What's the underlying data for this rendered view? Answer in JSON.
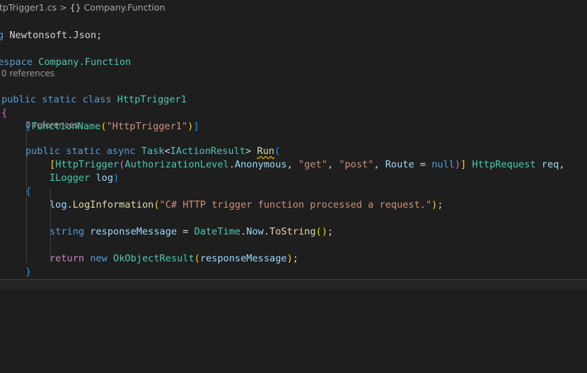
{
  "breadcrumb": {
    "file": "ttpTrigger1.cs",
    "separator": ">",
    "symbol_icon": "{}",
    "symbol": "Company.Function"
  },
  "code": {
    "l1_kw": "g",
    "l1_ns": "Newtonsoft.Json",
    "l1_semi": ";",
    "l2_kw": "espace",
    "l2_ns": "Company.Function",
    "lens1": "0 references",
    "l3_mods": "public static class",
    "l3_name": "HttpTrigger1",
    "l4_brace": "{",
    "l5_open": "[",
    "l5_attr": "FunctionName",
    "l5_p1": "(",
    "l5_str": "\"HttpTrigger1\"",
    "l5_p2": ")",
    "l5_close": "]",
    "lens2": "0 references",
    "l6_mods": "public static async",
    "l6_task": "Task",
    "l6_lt": "<",
    "l6_iface": "IActionResult",
    "l6_gt": ">",
    "l6_run": "Run",
    "l6_paren": "(",
    "l7_open": "[",
    "l7_attr": "HttpTrigger",
    "l7_p1": "(",
    "l7_enum": "AuthorizationLevel",
    "l7_dot": ".",
    "l7_member": "Anonymous",
    "l7_comma1": ", ",
    "l7_get": "\"get\"",
    "l7_comma2": ", ",
    "l7_post": "\"post\"",
    "l7_comma3": ", ",
    "l7_route": "Route",
    "l7_eq": " = ",
    "l7_null": "null",
    "l7_p2": ")",
    "l7_close": "]",
    "l7_type": "HttpRequest",
    "l7_param": "req",
    "l7_comma4": ",",
    "l8_type": "ILogger",
    "l8_param": "log",
    "l8_paren": ")",
    "l9_brace": "{",
    "l10_obj": "log",
    "l10_dot": ".",
    "l10_method": "LogInformation",
    "l10_p1": "(",
    "l10_str": "\"C# HTTP trigger function processed a request.\"",
    "l10_p2": ")",
    "l10_semi": ";",
    "l11_kw": "string",
    "l11_var": "responseMessage",
    "l11_eq": " = ",
    "l11_type": "DateTime",
    "l11_dot1": ".",
    "l11_prop": "Now",
    "l11_dot2": ".",
    "l11_method": "ToString",
    "l11_parens": "()",
    "l11_semi": ";",
    "l12_return": "return",
    "l12_new": "new",
    "l12_type": "OkObjectResult",
    "l12_p1": "(",
    "l12_arg": "responseMessage",
    "l12_p2": ")",
    "l12_semi": ";",
    "l13_brace": "}",
    "l14_brace": "}"
  },
  "colors": {
    "background": "#1e1e1e",
    "keyword": "#569cd6",
    "type": "#4ec9b0",
    "function": "#dcdcaa",
    "variable": "#9cdcfe",
    "string": "#ce9178",
    "control_keyword": "#c586c0"
  }
}
